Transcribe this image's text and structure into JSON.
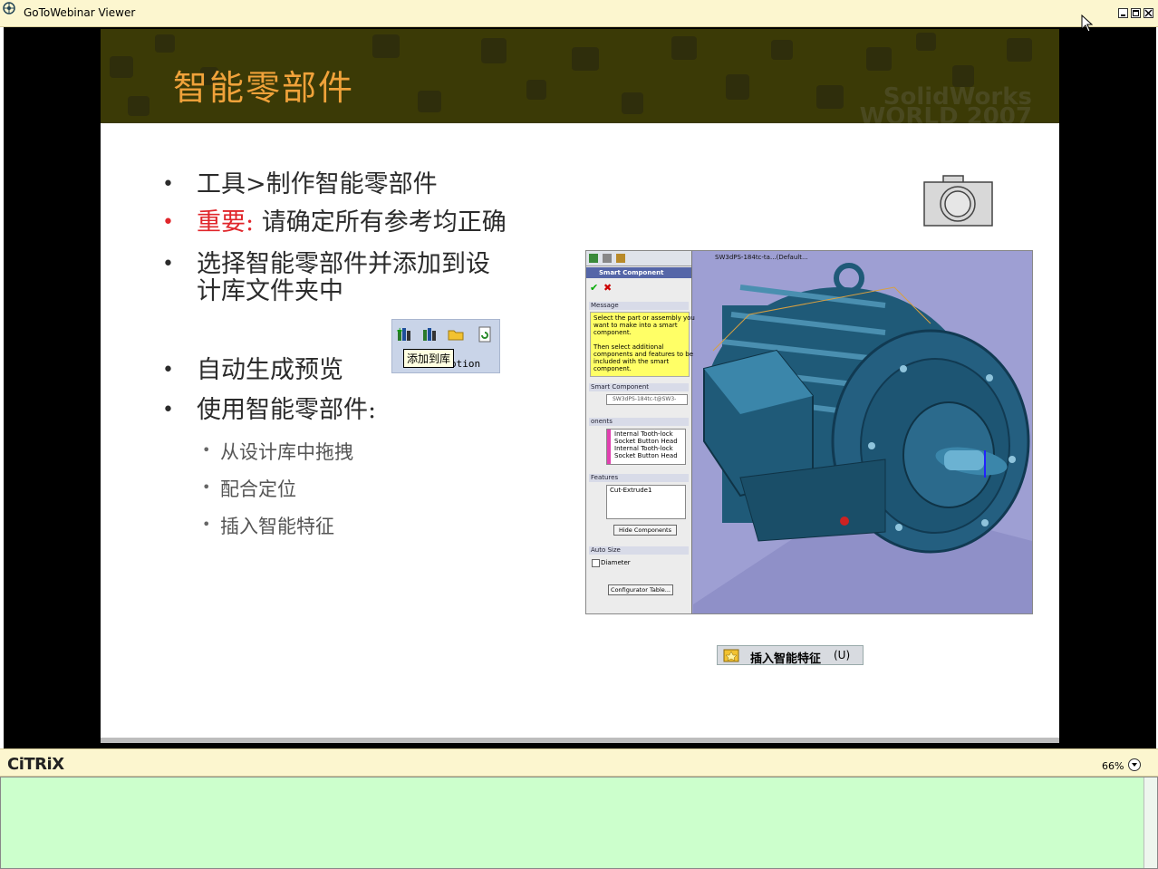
{
  "window": {
    "title": "GoToWebinar Viewer"
  },
  "slide": {
    "title": "智能零部件",
    "logo": "SolidWorks WORLD 2007",
    "bullets": [
      {
        "text": "工具>制作智能零部件"
      },
      {
        "label": "重要:",
        "text": " 请确定所有参考均正确"
      },
      {
        "line1": "选择智能零部件并添加到设",
        "line2": "计库文件夹中"
      },
      {
        "text": "自动生成预览"
      },
      {
        "text": "使用智能零部件:"
      }
    ],
    "sub_bullets": [
      "从设计库中拖拽",
      "配合定位",
      "插入智能特征"
    ],
    "toolbar_tooltip": "添加到库",
    "toolbar_under_text": "otion",
    "insert_feature": {
      "label": "插入智能特征",
      "shortcut": "(U)"
    },
    "colors": {
      "title": "#f0a23a",
      "important": "#e0262b",
      "header_bg": "#3b3a06"
    },
    "property_manager": {
      "title": "Smart Component",
      "file_tab": "SW3dPS-184tc-ta...(Default...",
      "message_header": "Message",
      "message_lines": [
        "Select the part or assembly you",
        "want to make into a smart",
        "component.",
        "",
        "Then select additional",
        "components and features to be",
        "included with the smart",
        "component."
      ],
      "smart_component_header": "Smart Component",
      "smart_component_value": "SW3dPS-184tc-t@SW3-",
      "components_header": "onents",
      "components_list": [
        "Internal Tooth-lock",
        "Socket Button Head",
        "Internal Tooth-lock",
        "Socket Button Head"
      ],
      "features_header": "Features",
      "features_list": [
        "Cut-Extrude1"
      ],
      "hide_components": "Hide Components",
      "auto_size_header": "Auto Size",
      "diameter_label": "Diameter",
      "configurator_button": "Configurator Table..."
    }
  },
  "status": {
    "logo": "CiTRiX",
    "zoom": "66%"
  }
}
